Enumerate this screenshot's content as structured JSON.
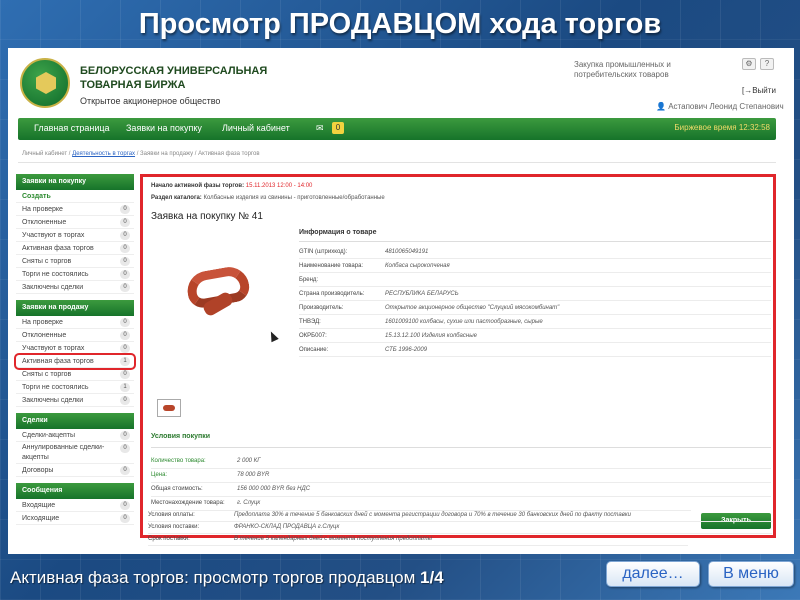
{
  "slide": {
    "title": "Просмотр ПРОДАВЦОМ хода торгов",
    "caption_prefix": "Активная фаза торгов: просмотр торгов продавцом",
    "caption_page": "1/4",
    "next_label": "далее…",
    "menu_label": "В меню"
  },
  "header": {
    "org_name": "БЕЛОРУССКАЯ УНИВЕРСАЛЬНАЯ ТОВАРНАЯ БИРЖА",
    "org_type": "Открытое акционерное общество",
    "section_link": "Закупка промышленных и потребительских товаров",
    "logout": "[→Выйти",
    "user": "Астапович Леонид Степанович"
  },
  "nav": {
    "items": [
      "Главная страница",
      "Заявки на покупку",
      "Личный кабинет"
    ],
    "badge": "0",
    "exchange_time": "Биржевое время 12:32:58"
  },
  "breadcrumb": {
    "part1": "Личный кабинет /",
    "link": "Деятельность в торгах",
    "part2": "/ Заявки на продажу / Активная фаза торгов"
  },
  "sidebar": {
    "buy": {
      "title": "Заявки на покупку",
      "create": "Создать",
      "items": [
        {
          "label": "На проверке",
          "count": "0"
        },
        {
          "label": "Отклоненные",
          "count": "0"
        },
        {
          "label": "Участвуют в торгах",
          "count": "0"
        },
        {
          "label": "Активная фаза торгов",
          "count": "0"
        },
        {
          "label": "Сняты с торгов",
          "count": "0"
        },
        {
          "label": "Торги не состоялись",
          "count": "0"
        },
        {
          "label": "Заключены сделки",
          "count": "0"
        }
      ]
    },
    "sell": {
      "title": "Заявки на продажу",
      "items": [
        {
          "label": "На проверке",
          "count": "0"
        },
        {
          "label": "Отклоненные",
          "count": "0"
        },
        {
          "label": "Участвуют в торгах",
          "count": "0"
        },
        {
          "label": "Активная фаза торгов",
          "count": "1"
        },
        {
          "label": "Сняты с торгов",
          "count": "0"
        },
        {
          "label": "Торги не состоялись",
          "count": "1"
        },
        {
          "label": "Заключены сделки",
          "count": "0"
        }
      ]
    },
    "deals": {
      "title": "Сделки",
      "items": [
        {
          "label": "Сделки-акцепты",
          "count": "0"
        },
        {
          "label": "Аннулированные сделки-акцепты",
          "count": "0"
        },
        {
          "label": "Договоры",
          "count": "0"
        }
      ]
    },
    "messages": {
      "title": "Сообщения",
      "items": [
        {
          "label": "Входящие",
          "count": "0"
        },
        {
          "label": "Исходящие",
          "count": "0"
        }
      ]
    }
  },
  "main": {
    "start_label": "Начало активной фазы торгов:",
    "start_value": "15.11.2013 12:00 - 14:00",
    "catalog_label": "Раздел каталога:",
    "catalog_value": "Колбасные изделия из свинины - приготовленные/обработанные",
    "title": "Заявка на покупку № 41",
    "info_title": "Информация о товаре",
    "info": [
      {
        "k": "GTIN (штрихкод):",
        "v": "4810065049191"
      },
      {
        "k": "Наименование товара:",
        "v": "Колбаса сырокопченая"
      },
      {
        "k": "Бренд:",
        "v": ""
      },
      {
        "k": "Страна производитель:",
        "v": "РЕСПУБЛИКА БЕЛАРУСЬ"
      },
      {
        "k": "Производитель:",
        "v": "Открытое акционерное общество \"Слуцкий мясокомбинат\""
      },
      {
        "k": "ТНВЭД:",
        "v": "1601009100 колбасы, сухие или пастообразные, сырые"
      },
      {
        "k": "ОКРБ007:",
        "v": "15.13.12.100 Изделия колбасные"
      },
      {
        "k": "Описание:",
        "v": "СТБ 1996-2009"
      }
    ],
    "conditions_title": "Условия покупки",
    "conditions": [
      {
        "k": "Количество товара:",
        "v": "2 000 КГ",
        "green": true
      },
      {
        "k": "Цена:",
        "v": "78 000 BYR",
        "green": true
      },
      {
        "k": "Общая стоимость:",
        "v": "156 000 000 BYR без НДС",
        "green": false
      },
      {
        "k": "Местонахождение товара:",
        "v": "г. Слуцк",
        "green": false
      },
      {
        "k": "Условия оплаты:",
        "v": "Предоплата 30% в течение 5 банковских дней с момента регистрации договора и 70% в течение 30 банковских дней по факту поставки",
        "green": false
      },
      {
        "k": "Условия поставки:",
        "v": "ФРАНКО-СКЛАД ПРОДАВЦА г.Слуцк",
        "green": false
      },
      {
        "k": "Срок поставки:",
        "v": "В течение 5 календарных дней с момента поступления предоплаты",
        "green": false
      }
    ],
    "close_label": "Закрыть"
  }
}
